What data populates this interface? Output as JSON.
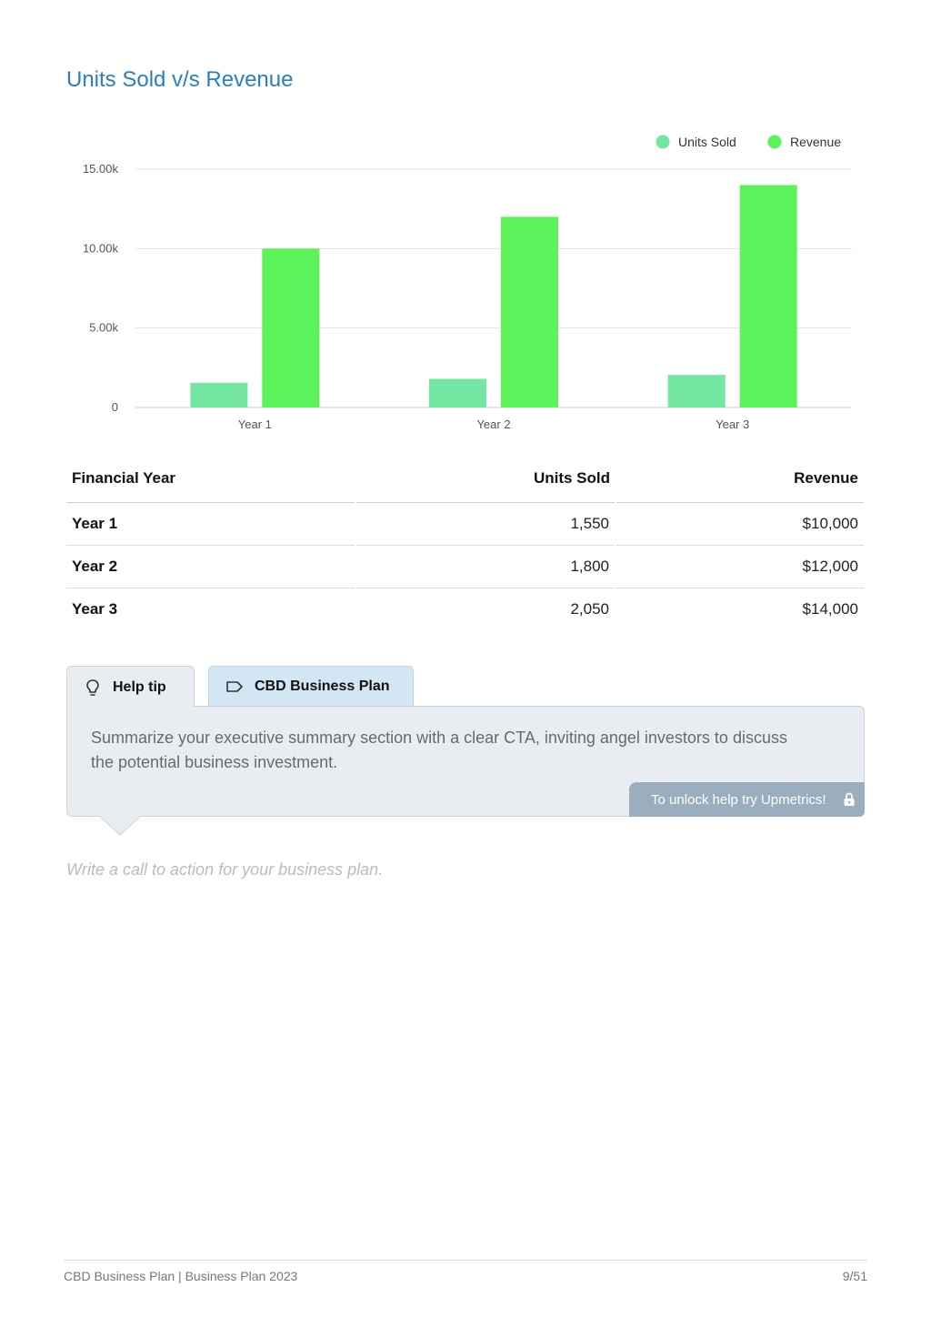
{
  "page": {
    "title": "Units Sold v/s Revenue"
  },
  "chart_data": {
    "type": "bar",
    "categories": [
      "Year 1",
      "Year 2",
      "Year 3"
    ],
    "series": [
      {
        "name": "Units Sold",
        "values": [
          1550,
          1800,
          2050
        ],
        "color": "#73e6a2"
      },
      {
        "name": "Revenue",
        "values": [
          10000,
          12000,
          14000
        ],
        "color": "#5cf25a"
      }
    ],
    "ylim": [
      0,
      15000
    ],
    "yticks": [
      0,
      5000,
      10000,
      15000
    ],
    "ytick_labels": [
      "0",
      "5.00k",
      "10.00k",
      "15.00k"
    ],
    "grid": true,
    "legend": "top-right",
    "title": "",
    "xlabel": "",
    "ylabel": ""
  },
  "table": {
    "headers": [
      "Financial Year",
      "Units Sold",
      "Revenue"
    ],
    "rows": [
      [
        "Year 1",
        "1,550",
        "$10,000"
      ],
      [
        "Year 2",
        "1,800",
        "$12,000"
      ],
      [
        "Year 3",
        "2,050",
        "$14,000"
      ]
    ]
  },
  "tabs": {
    "help_tip": "Help tip",
    "plan": "CBD Business Plan"
  },
  "help": {
    "text": "Summarize your executive summary section with a clear CTA, inviting angel investors to discuss the potential business investment.",
    "unlock_label": "To unlock help try Upmetrics!"
  },
  "cta_placeholder": "Write a call to action for your business plan.",
  "footer": {
    "left": "CBD Business Plan | Business Plan 2023",
    "right": "9/51"
  },
  "icons": {
    "help_tab": "lightbulb-icon",
    "plan_tab": "tag-icon",
    "unlock": "lock-icon"
  }
}
